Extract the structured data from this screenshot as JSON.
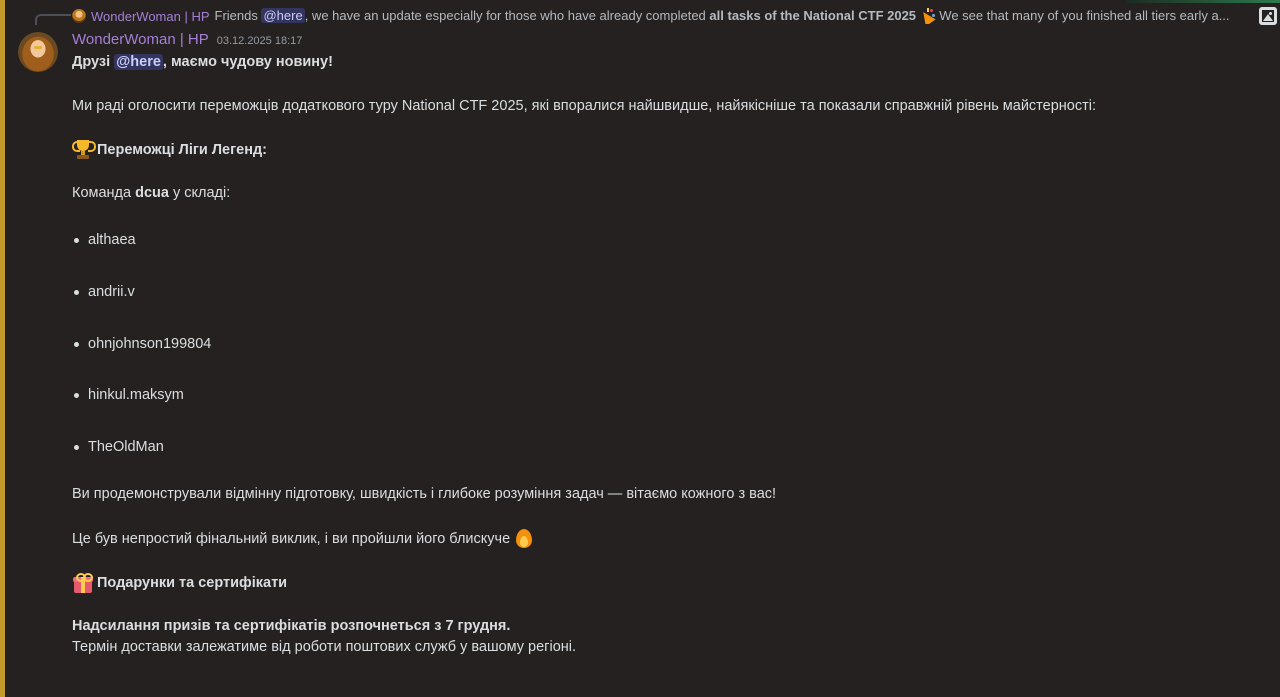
{
  "reply": {
    "author": "WonderWoman | HP",
    "text_before": "Friends",
    "mention": "@here",
    "text_middle": ", we have an update especially for those who have already completed",
    "text_bold": "all tasks of the National CTF 2025",
    "text_after": "We see that many of you finished all tiers early  a..."
  },
  "message": {
    "author": "WonderWoman | HP",
    "timestamp": "03.12.2025 18:17",
    "greeting_before": "Друзі",
    "greeting_mention": "@here",
    "greeting_after": ", маємо чудову новину!",
    "intro": "Ми раді оголосити переможців додаткового туру National CTF 2025, які впоралися найшвидше, найякісніше та показали справжній рівень майстерності:",
    "winners_heading": "Переможці Ліги Легенд:",
    "team_prefix": "Команда",
    "team_name": "dcua",
    "team_suffix": "у складі:",
    "members": [
      "althaea",
      "andrii.v",
      "ohnjohnson199804",
      "hinkul.maksym",
      "TheOldMan"
    ],
    "praise": "Ви продемонстрували відмінну підготовку, швидкість і глибоке розуміння задач — вітаємо кожного з вас!",
    "challenge": "Це був непростий фінальний виклик, і ви пройшли його блискуче",
    "gifts_heading": "Подарунки та сертифікати",
    "shipping_bold": "Надсилання призів та сертифікатів розпочнеться з 7 грудня.",
    "shipping_note": "Термін доставки залежатиме від роботи поштових служб у вашому регіоні."
  },
  "colors": {
    "author": "#a57fd6",
    "mention_bg": "#3b3f8c",
    "background": "#242120",
    "left_accent": "#c29a2c"
  },
  "icons": {
    "reply_avatar": "avatar-icon",
    "party": "party-popper-icon",
    "image_attachment": "image-icon",
    "trophy": "trophy-icon",
    "fire": "fire-icon",
    "gift": "gift-icon"
  }
}
